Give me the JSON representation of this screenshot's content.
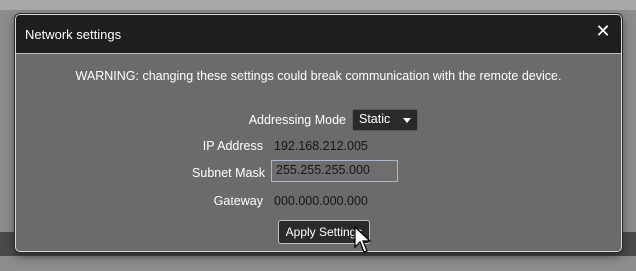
{
  "dialog": {
    "title": "Network settings",
    "close_glyph": "✕",
    "warning": "WARNING: changing these settings could break communication with the remote device.",
    "addressing_mode": {
      "label": "Addressing Mode",
      "value": "Static"
    },
    "ip_address": {
      "label": "IP Address",
      "value": "192.168.212.005"
    },
    "subnet_mask": {
      "label": "Subnet Mask",
      "value": "255.255.255.000"
    },
    "gateway": {
      "label": "Gateway",
      "value": "000.000.000.000"
    },
    "apply_button": "Apply Settings"
  },
  "colors": {
    "titlebar": "#1e1e1e",
    "dialog_body": "#6b6b6b",
    "button_bg": "#2a2a2a",
    "input_focus_border": "#a9b7c6"
  },
  "icons": {
    "close": "close-icon",
    "dropdown": "chevron-down-icon",
    "cursor": "pointer-cursor-icon"
  }
}
